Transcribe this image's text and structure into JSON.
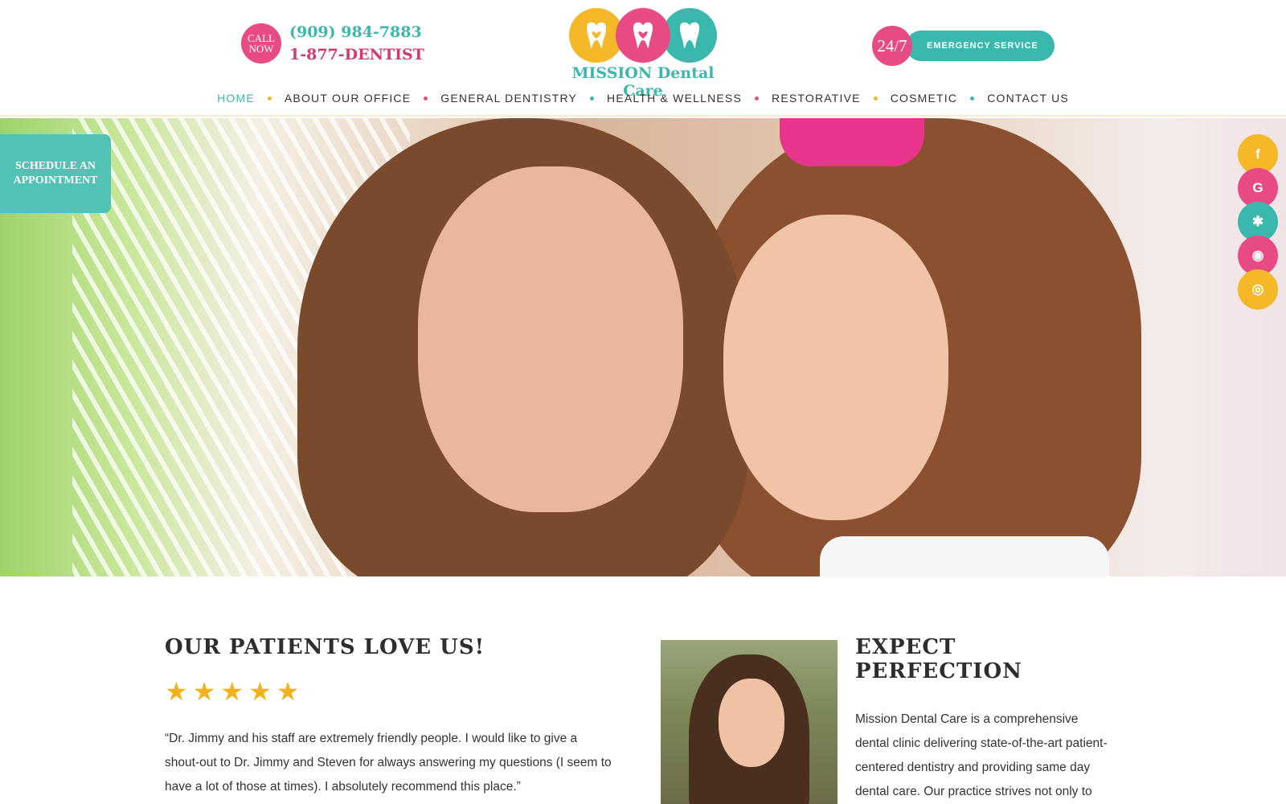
{
  "header": {
    "call_badge_line1": "CALL",
    "call_badge_line2": "NOW",
    "phone_primary": "(909) 984-7883",
    "phone_secondary": "1-877-DENTIST",
    "logo_text": "MISSION Dental Care",
    "emergency_badge": "24/7",
    "emergency_label": "EMERGENCY SERVICE"
  },
  "nav": {
    "items": [
      {
        "label": "HOME"
      },
      {
        "label": "ABOUT OUR OFFICE"
      },
      {
        "label": "GENERAL DENTISTRY"
      },
      {
        "label": "HEALTH & WELLNESS"
      },
      {
        "label": "RESTORATIVE"
      },
      {
        "label": "COSMETIC"
      },
      {
        "label": "CONTACT US"
      }
    ]
  },
  "hero": {
    "schedule_line1": "SCHEDULE AN",
    "schedule_line2": "APPOINTMENT"
  },
  "social": [
    {
      "icon": "facebook-icon",
      "glyph": "f",
      "color": "#f4b829"
    },
    {
      "icon": "google-icon",
      "glyph": "G",
      "color": "#e84a83"
    },
    {
      "icon": "yelp-icon",
      "glyph": "✱",
      "color": "#3bb8ae"
    },
    {
      "icon": "rss-icon",
      "glyph": "◉",
      "color": "#e84a83"
    },
    {
      "icon": "instagram-icon",
      "glyph": "◎",
      "color": "#f4b829"
    }
  ],
  "reviews": {
    "title": "OUR PATIENTS LOVE US!",
    "rating": 5,
    "quote": "“Dr. Jimmy and his staff are extremely friendly people. I would like to give a shout-out to Dr. Jimmy and Steven for always answering my questions (I seem to have a lot of those at times). I absolutely recommend this place.”"
  },
  "about": {
    "title": "EXPECT PERFECTION",
    "text": "Mission Dental Care is a comprehensive dental clinic delivering state-of-the-art patient-centered dentistry and providing same day dental care. Our practice strives not only to improve the health and well-"
  },
  "colors": {
    "teal": "#3bb8ae",
    "pink": "#e84a83",
    "yellow": "#f4b829"
  }
}
